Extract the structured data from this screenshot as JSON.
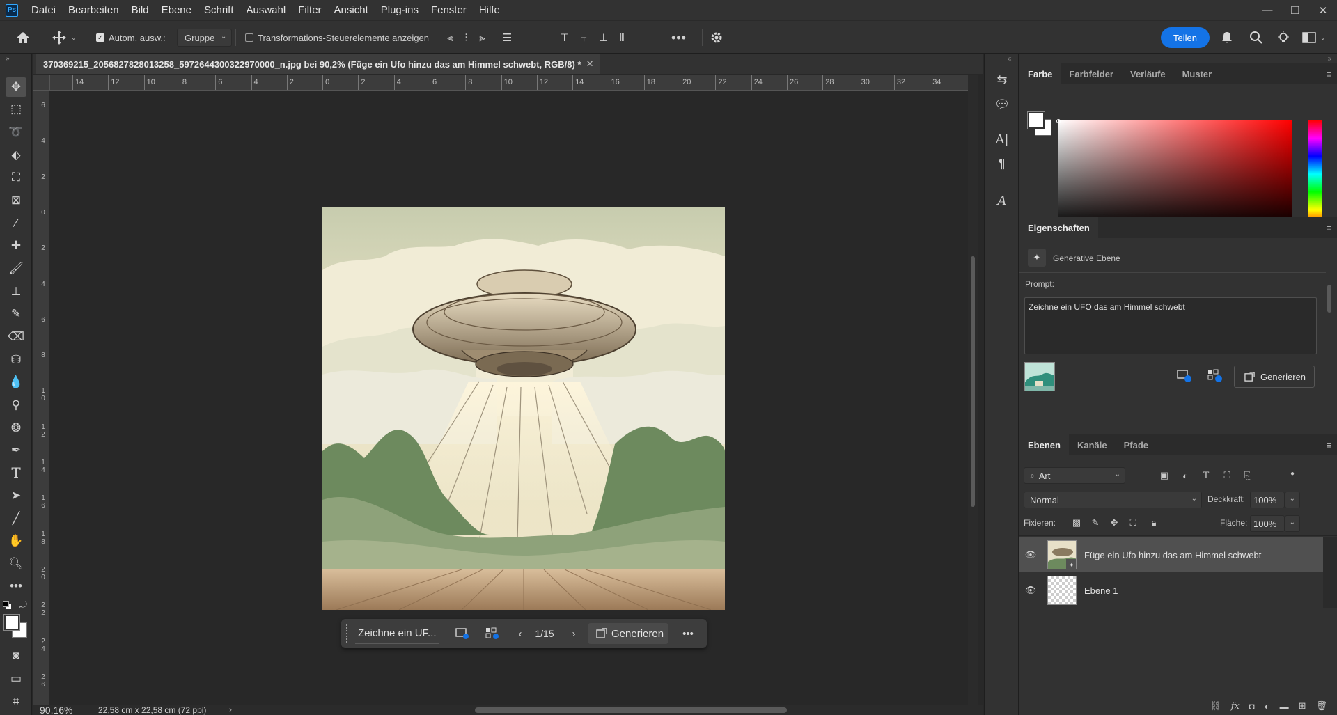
{
  "app": {
    "logo": "Ps"
  },
  "menu": [
    "Datei",
    "Bearbeiten",
    "Bild",
    "Ebene",
    "Schrift",
    "Auswahl",
    "Filter",
    "Ansicht",
    "Plug-ins",
    "Fenster",
    "Hilfe"
  ],
  "window": {
    "minimize": "—",
    "maximize": "❐",
    "close": "✕"
  },
  "options": {
    "auto_select_label": "Autom. ausw.:",
    "auto_select_checked": true,
    "group_value": "Gruppe",
    "transform_label": "Transformations-Steuerelemente anzeigen",
    "transform_checked": false,
    "share_label": "Teilen"
  },
  "document": {
    "tab_title": "370369215_2056827828013258_5972644300322970000_n.jpg bei 90,2% (Füge ein Ufo hinzu das am Himmel schwebt, RGB/8) *",
    "close": "✕"
  },
  "rulers": {
    "top": [
      "14",
      "12",
      "10",
      "8",
      "6",
      "4",
      "2",
      "0",
      "2",
      "4",
      "6",
      "8",
      "10",
      "12",
      "14",
      "16",
      "18",
      "20",
      "22",
      "24",
      "26",
      "28",
      "30",
      "32",
      "34"
    ],
    "left": [
      "6",
      "4",
      "2",
      "0",
      "2",
      "4",
      "6",
      "8",
      "1 0",
      "1 2",
      "1 4",
      "1 6",
      "1 8",
      "2 0",
      "2 2",
      "2 4",
      "2 6"
    ]
  },
  "taskbar": {
    "prompt": "Zeichne ein UF...",
    "page": "1/15",
    "generate_label": "Generieren",
    "more": "•••"
  },
  "status": {
    "zoom": "90.16%",
    "dims": "22,58 cm x 22,58 cm (72 ppi)"
  },
  "panels": {
    "color_tabs": [
      "Farbe",
      "Farbfelder",
      "Verläufe",
      "Muster"
    ],
    "properties_tab": "Eigenschaften",
    "properties_type": "Generative Ebene",
    "prompt_label": "Prompt:",
    "prompt_text": "Zeichne ein UFO das am Himmel schwebt",
    "generate_label": "Generieren",
    "layers_tabs": [
      "Ebenen",
      "Kanäle",
      "Pfade"
    ],
    "filter_value": "Art",
    "blend_mode": "Normal",
    "opacity_label": "Deckkraft:",
    "opacity_value": "100%",
    "lock_label": "Fixieren:",
    "fill_label": "Fläche:",
    "fill_value": "100%",
    "layers": [
      {
        "name": "Füge ein Ufo hinzu das am Himmel schwebt",
        "selected": true
      },
      {
        "name": "Ebene 1",
        "selected": false
      }
    ]
  },
  "colors": {
    "accent": "#1473e6",
    "background": "#282828",
    "panel": "#323232"
  }
}
